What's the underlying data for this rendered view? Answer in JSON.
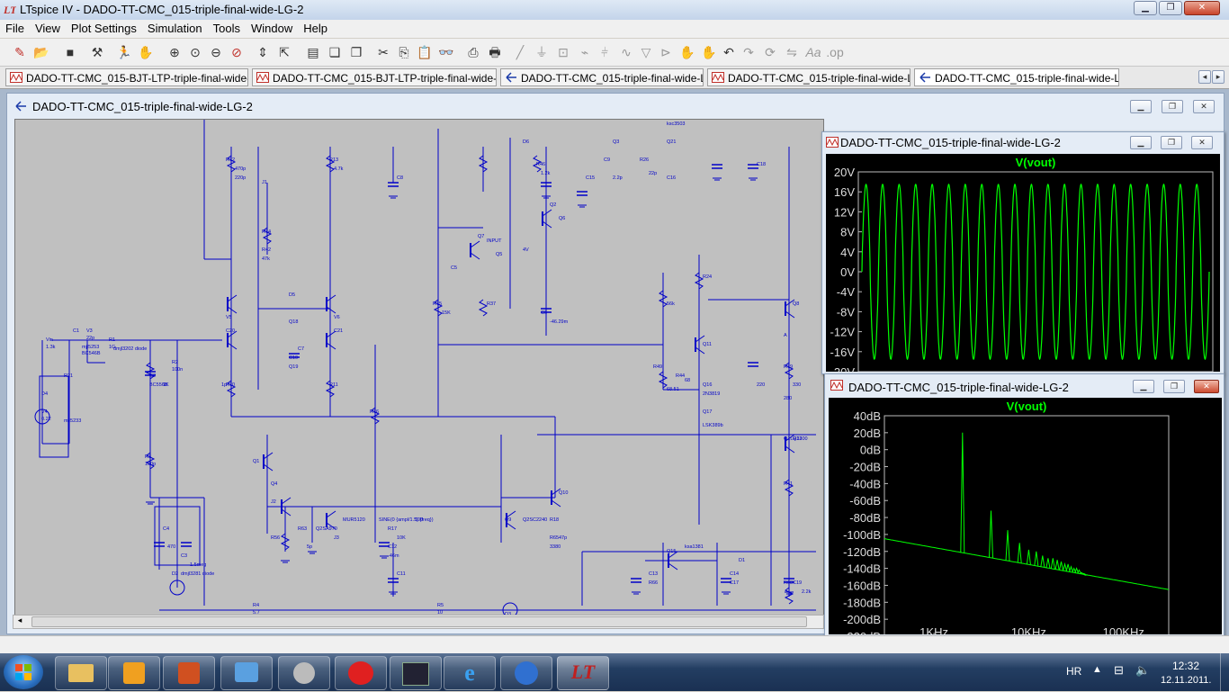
{
  "window": {
    "title": "LTspice IV - DADO-TT-CMC_015-triple-final-wide-LG-2"
  },
  "menu": [
    "File",
    "View",
    "Plot Settings",
    "Simulation",
    "Tools",
    "Window",
    "Help"
  ],
  "tabs": [
    {
      "label": "DADO-TT-CMC_015-BJT-LTP-triple-final-wide-LG-2",
      "kind": "plot"
    },
    {
      "label": "DADO-TT-CMC_015-BJT-LTP-triple-final-wide-LG-2",
      "kind": "plot"
    },
    {
      "label": "DADO-TT-CMC_015-triple-final-wide-LG-2",
      "kind": "schematic"
    },
    {
      "label": "DADO-TT-CMC_015-triple-final-wide-LG-2",
      "kind": "plot"
    },
    {
      "label": "DADO-TT-CMC_015-triple-final-wide-LG-2",
      "kind": "schematic"
    }
  ],
  "schematic": {
    "title": "DADO-TT-CMC_015-triple-final-wide-LG-2",
    "labels": [
      "Vin",
      "V3",
      "V4",
      "R1",
      "R2",
      "R3",
      "R4",
      "R5",
      "R10",
      "R11",
      "R12",
      "R13",
      "R14",
      "R15",
      "R16",
      "R17",
      "R18",
      "R19",
      "R21",
      "R24",
      "R26",
      "R37",
      "R41",
      "R42",
      "R44",
      "R46",
      "R49",
      "R56",
      "R63",
      "R65",
      "R66",
      "R68",
      "C1",
      "C2",
      "C3",
      "C4",
      "C5",
      "C6",
      "C7",
      "C8",
      "C9",
      "C10",
      "C11",
      "C12",
      "C13",
      "C14",
      "C15",
      "C16",
      "C17",
      "C18",
      "C19",
      "C20",
      "C21",
      "J1",
      "J2",
      "J3",
      "Q1",
      "Q2",
      "Q3",
      "Q4",
      "Q5",
      "Q6",
      "Q7",
      "Q8",
      "Q9",
      "Q10",
      "Q11",
      "Q12",
      "Q15",
      "Q16",
      "Q17",
      "Q18",
      "Q19",
      "Q21",
      "D1",
      "D2",
      "D3",
      "D4",
      "D5",
      "D6",
      "V5",
      "V6",
      "INPUT",
      "4V",
      "A",
      "Q1LR3300",
      "2N3819",
      "LSK389b",
      "Q2SC2240",
      "Q2SA970",
      "ksa1381",
      "ksc3503",
      "mjl5233",
      "mjl5253",
      "dmjl3281 diode",
      "dmjl3202 diode",
      "BC546B",
      "BC556B",
      "MUR5120",
      "SINE(0 {ampl/1.5} {freq})",
      "-46m",
      "-46.29m",
      "1.2k",
      "2.2p",
      "22p",
      "100",
      "10K",
      "1K",
      "47p",
      "5p",
      "1p",
      "220p",
      "470p",
      "47k",
      "4.7k",
      "15K",
      "56k",
      "68.51",
      "68",
      "220",
      "280",
      "330",
      "470",
      "1.5meg",
      "2.2k",
      "3380",
      "1.3k",
      "22p",
      "0.22",
      "1G",
      "100n",
      "100p",
      "5.7",
      "10"
    ]
  },
  "plot_time": {
    "window_title": "DADO-TT-CMC_015-triple-final-wide-LG-2",
    "trace": "V(vout)",
    "color": "#00ff00",
    "yticks": [
      "20V",
      "16V",
      "12V",
      "8V",
      "4V",
      "0V",
      "-4V",
      "-8V",
      "-12V",
      "-16V",
      "-20V"
    ],
    "ylim": [
      -20,
      20
    ],
    "amplitude": 17.5,
    "cycles": 21
  },
  "plot_fft": {
    "window_title": "DADO-TT-CMC_015-triple-final-wide-LG-2",
    "trace": "V(vout)",
    "color": "#00ff00",
    "yticks": [
      "40dB",
      "20dB",
      "0dB",
      "-20dB",
      "-40dB",
      "-60dB",
      "-80dB",
      "-100dB",
      "-120dB",
      "-140dB",
      "-160dB",
      "-180dB",
      "-200dB",
      "-220dB"
    ],
    "xticks": [
      "1KHz",
      "10KHz",
      "100KHz"
    ],
    "ylim": [
      -220,
      40
    ],
    "fundamental": {
      "freq_khz": 2,
      "level_db": 20
    },
    "harmonic_peaks_db": [
      20,
      -72,
      -95,
      -110,
      -118,
      -120,
      -125,
      -128,
      -128,
      -130,
      -132,
      -135,
      -135,
      -138,
      -140,
      -140,
      -142,
      -145,
      -146,
      -148
    ],
    "noise_floor_db": [
      -105,
      -165
    ]
  },
  "tray": {
    "lang": "HR",
    "time": "12:32",
    "date": "12.11.2011."
  }
}
